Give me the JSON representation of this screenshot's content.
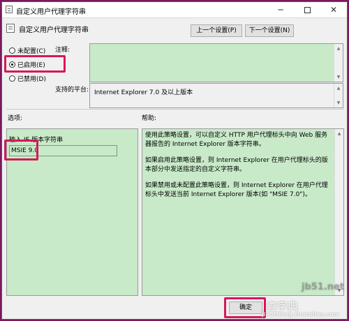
{
  "window": {
    "title": "自定义用户代理字符串",
    "controls": {
      "minimize": "─",
      "close": "✕"
    }
  },
  "header": {
    "policy_name": "自定义用户代理字符串",
    "prev_button": "上一个设置(P)",
    "next_button": "下一个设置(N)"
  },
  "state_options": [
    {
      "label": "未配置(C)",
      "checked": false
    },
    {
      "label": "已启用(E)",
      "checked": true
    },
    {
      "label": "已禁用(D)",
      "checked": false
    }
  ],
  "comment": {
    "label": "注释:",
    "value": ""
  },
  "supported": {
    "label": "支持的平台:",
    "value": "Internet Explorer 7.0 及以上版本"
  },
  "options": {
    "heading": "选项:",
    "field_label": "输入 IE 版本字符串",
    "field_value": "MSIE 9.0"
  },
  "help": {
    "heading": "帮助:",
    "paragraphs": [
      "使用此策略设置，可以自定义 HTTP 用户代理标头中向 Web 服务器报告的 Internet Explorer 版本字符串。",
      "如果启用此策略设置，则 Internet Explorer 在用户代理标头的版本部分中发送指定的自定义字符串。",
      "如果禁用或未配置此策略设置，则 Internet Explorer 在用户代理标头中发送当前 Internet Explorer 版本(如 \"MSIE 7.0\")。"
    ]
  },
  "footer": {
    "ok_button": "确定"
  },
  "watermarks": {
    "top_right": "jb51.net",
    "bottom_left": "查字典",
    "bottom_right": "jiaocheng.chazidian.com"
  },
  "colors": {
    "highlight": "#d6185a",
    "green_field": "#c8eac9",
    "outer_background": "#7a1a5e"
  }
}
